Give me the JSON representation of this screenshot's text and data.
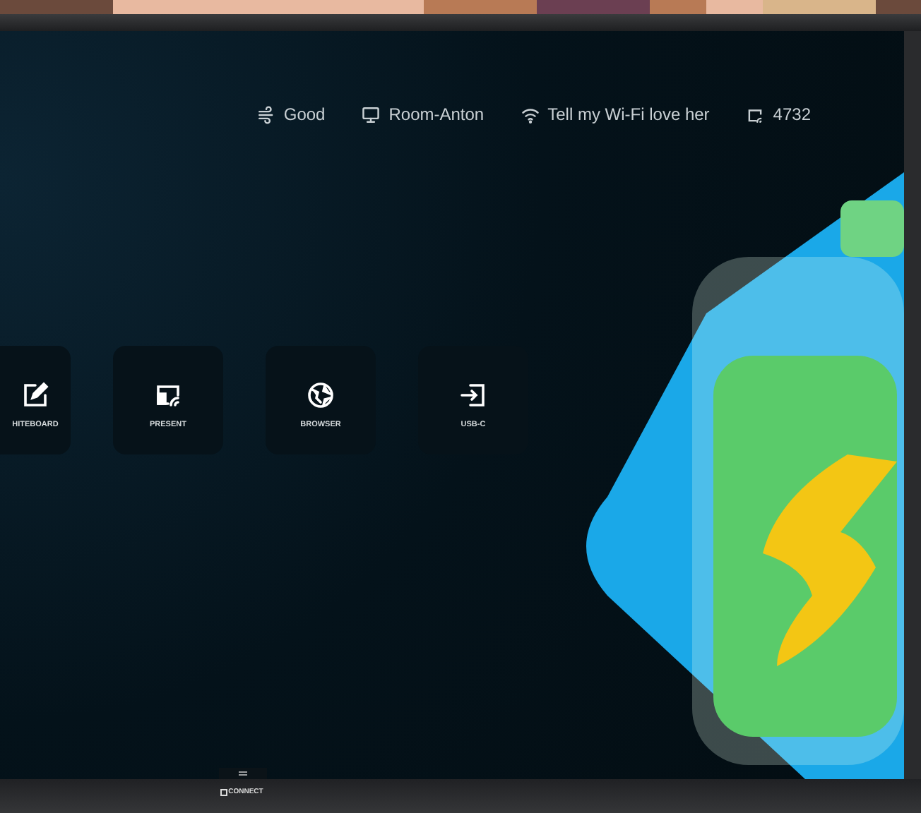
{
  "status_bar": [
    {
      "kind": "air",
      "label": "Good"
    },
    {
      "kind": "display",
      "label": "Room-Anton"
    },
    {
      "kind": "wifi",
      "label": "Tell my Wi-Fi love her"
    },
    {
      "kind": "cast",
      "label": "4732"
    }
  ],
  "apps": [
    {
      "kind": "whiteboard",
      "label": "HITEBOARD"
    },
    {
      "kind": "present",
      "label": "PRESENT"
    },
    {
      "kind": "browser",
      "label": "BROWSER"
    },
    {
      "kind": "usb",
      "label": "USB-C"
    }
  ],
  "bezel": {
    "brand": "CONNECT"
  }
}
